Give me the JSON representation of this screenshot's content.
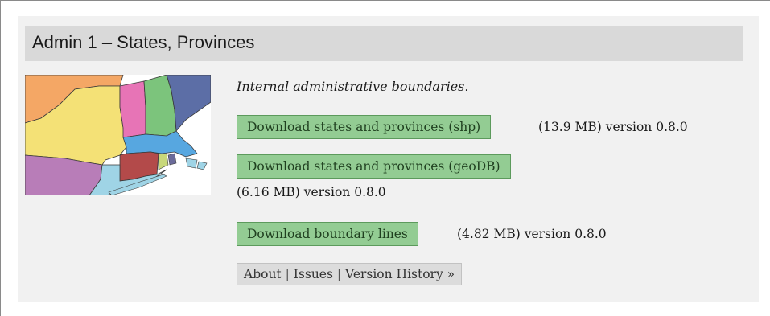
{
  "section": {
    "title": "Admin 1 – States, Provinces",
    "description": "Internal administrative boundaries."
  },
  "downloads": [
    {
      "label": "Download states and provinces (shp)",
      "meta": "(13.9 MB) version 0.8.0"
    },
    {
      "label": "Download states and provinces (geoDB)",
      "meta": "(6.16 MB) version 0.8.0"
    },
    {
      "label": "Download boundary lines",
      "meta": "(4.82 MB) version 0.8.0"
    }
  ],
  "links": {
    "about": "About",
    "separator": "|",
    "issues": "Issues",
    "version_history": "Version History »"
  },
  "thumbnail": {
    "icon": "map-thumbnail-northeast-states",
    "colors": [
      "#f4a765",
      "#e774b6",
      "#f4e176",
      "#7cc47c",
      "#5c6ea6",
      "#b87db8",
      "#b34a4a",
      "#9fd4e6"
    ]
  }
}
